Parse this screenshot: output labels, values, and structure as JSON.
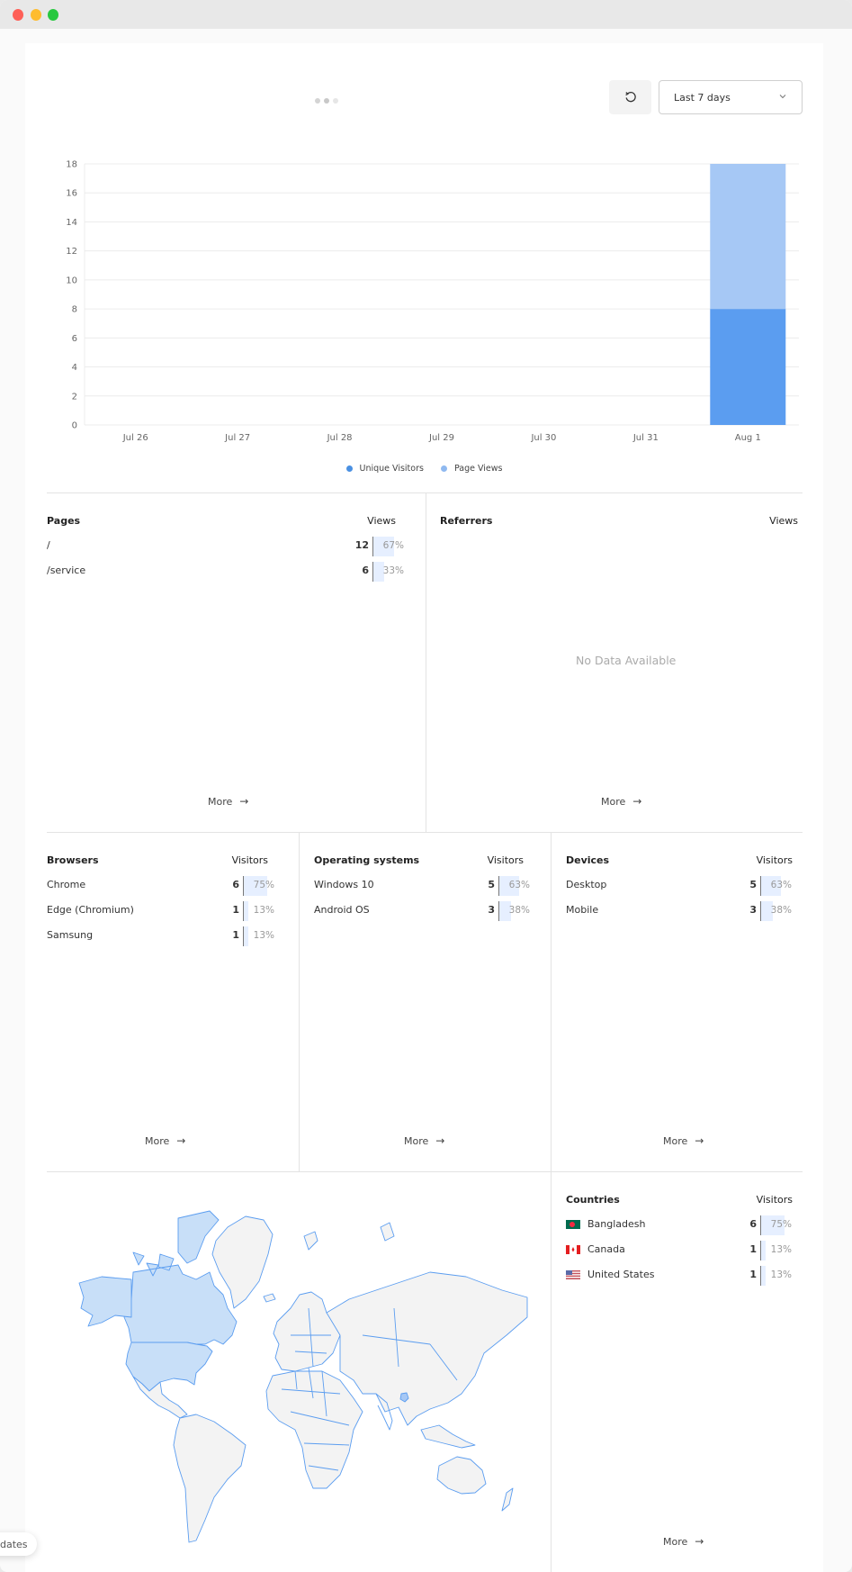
{
  "window": {
    "controls": [
      "close",
      "minimize",
      "maximize"
    ]
  },
  "toolbar": {
    "refresh_icon": "refresh-icon",
    "date_range": "Last 7 days",
    "dropdown_icon": "chevron-down-icon"
  },
  "chart_data": {
    "type": "bar",
    "stacked": true,
    "categories": [
      "Jul 26",
      "Jul 27",
      "Jul 28",
      "Jul 29",
      "Jul 30",
      "Jul 31",
      "Aug 1"
    ],
    "series": [
      {
        "name": "Unique Visitors",
        "color": "#5b9df0",
        "values": [
          0,
          0,
          0,
          0,
          0,
          0,
          8
        ]
      },
      {
        "name": "Page Views",
        "color": "#a6c8f5",
        "values": [
          0,
          0,
          0,
          0,
          0,
          0,
          10
        ]
      }
    ],
    "yticks": [
      "0",
      "2",
      "4",
      "6",
      "8",
      "10",
      "12",
      "14",
      "16",
      "18"
    ],
    "ylim": [
      0,
      18
    ],
    "xlabel": "",
    "ylabel": "",
    "grid": true,
    "legend": "bottom-center"
  },
  "legend": [
    {
      "label": "Unique Visitors",
      "color": "#4a90e2"
    },
    {
      "label": "Page Views",
      "color": "#8fb9f0"
    }
  ],
  "pages": {
    "title": "Pages",
    "metric": "Views",
    "rows": [
      {
        "label": "/",
        "count": "12",
        "pct": "67%",
        "fraction": 0.67
      },
      {
        "label": "/service",
        "count": "6",
        "pct": "33%",
        "fraction": 0.33
      }
    ],
    "more": "More"
  },
  "referrers": {
    "title": "Referrers",
    "metric": "Views",
    "empty": "No Data Available",
    "more": "More"
  },
  "browsers": {
    "title": "Browsers",
    "metric": "Visitors",
    "rows": [
      {
        "label": "Chrome",
        "count": "6",
        "pct": "75%",
        "fraction": 0.75
      },
      {
        "label": "Edge (Chromium)",
        "count": "1",
        "pct": "13%",
        "fraction": 0.13
      },
      {
        "label": "Samsung",
        "count": "1",
        "pct": "13%",
        "fraction": 0.13
      }
    ],
    "more": "More"
  },
  "os": {
    "title": "Operating systems",
    "metric": "Visitors",
    "rows": [
      {
        "label": "Windows 10",
        "count": "5",
        "pct": "63%",
        "fraction": 0.63
      },
      {
        "label": "Android OS",
        "count": "3",
        "pct": "38%",
        "fraction": 0.38
      }
    ],
    "more": "More"
  },
  "devices": {
    "title": "Devices",
    "metric": "Visitors",
    "rows": [
      {
        "label": "Desktop",
        "count": "5",
        "pct": "63%",
        "fraction": 0.63
      },
      {
        "label": "Mobile",
        "count": "3",
        "pct": "38%",
        "fraction": 0.38
      }
    ],
    "more": "More"
  },
  "countries": {
    "title": "Countries",
    "metric": "Visitors",
    "rows": [
      {
        "label": "Bangladesh",
        "flag": "bangladesh-flag-icon",
        "count": "6",
        "pct": "75%",
        "fraction": 0.75
      },
      {
        "label": "Canada",
        "flag": "canada-flag-icon",
        "count": "1",
        "pct": "13%",
        "fraction": 0.13
      },
      {
        "label": "United States",
        "flag": "us-flag-icon",
        "count": "1",
        "pct": "13%",
        "fraction": 0.13
      }
    ],
    "more": "More"
  },
  "map": {
    "highlighted": [
      "Canada",
      "United States",
      "Bangladesh"
    ],
    "highlight_color": "#c8dff8",
    "border_color": "#4a90e2",
    "land_color": "#f3f3f3"
  },
  "updates_pill": "dates"
}
